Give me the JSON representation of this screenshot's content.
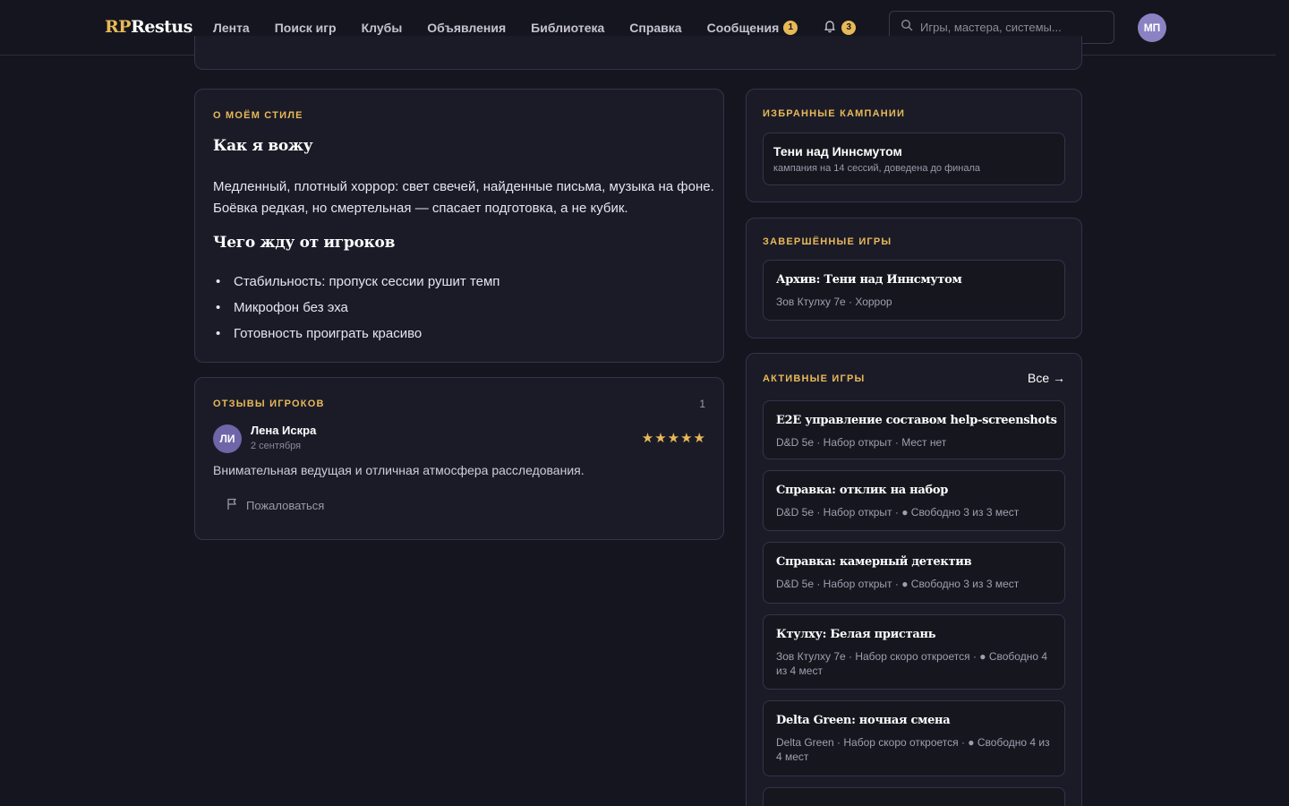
{
  "header": {
    "logo_rp": "RP",
    "logo_rest": "Restus",
    "nav": [
      {
        "label": "Лента"
      },
      {
        "label": "Поиск игр"
      },
      {
        "label": "Клубы"
      },
      {
        "label": "Объявления"
      },
      {
        "label": "Библиотека"
      },
      {
        "label": "Справка"
      },
      {
        "label": "Сообщения",
        "badge": "1"
      }
    ],
    "notifications_badge": "3",
    "search_placeholder": "Игры, мастера, системы...",
    "avatar_initials": "МП"
  },
  "style": {
    "section_title": "О моём стиле",
    "heading1": "Как я вожу",
    "paragraph": "Медленный, плотный хоррор: свет свечей, найденные письма, музыка на фоне. Боёвка редкая, но смертельная — спасает подготовка, а не кубик.",
    "heading2": "Чего жду от игроков",
    "bullets": [
      "Стабильность: пропуск сессии рушит темп",
      "Микрофон без эха",
      "Готовность проиграть красиво"
    ]
  },
  "reviews": {
    "section_title": "Отзывы игроков",
    "count": "1",
    "items": [
      {
        "initials": "ЛИ",
        "name": "Лена Искра",
        "date": "2 сентября",
        "rating": 5,
        "text": "Внимательная ведущая и отличная атмосфера расследования.",
        "report_label": "Пожаловаться"
      }
    ]
  },
  "favorites": {
    "section_title": "Избранные кампании",
    "items": [
      {
        "title": "Тени над Иннсмутом",
        "subtitle": "кампания на 14 сессий, доведена до финала"
      }
    ]
  },
  "completed": {
    "section_title": "Завершённые игры",
    "items": [
      {
        "title": "Архив: Тени над Иннсмутом",
        "subtitle": "Зов Ктулху 7е · Хоррор"
      }
    ]
  },
  "active": {
    "section_title": "Активные игры",
    "all_link": "Все →",
    "items": [
      {
        "title": "E2E управление составом help-screenshots",
        "subtitle": "D&D 5e · Набор открыт · Мест нет"
      },
      {
        "title": "Справка: отклик на набор",
        "subtitle": "D&D 5e · Набор открыт · ● Свободно 3 из 3 мест"
      },
      {
        "title": "Справка: камерный детектив",
        "subtitle": "D&D 5e · Набор открыт · ● Свободно 3 из 3 мест"
      },
      {
        "title": "Ктулху: Белая пристань",
        "subtitle": "Зов Ктулху 7е · Набор скоро откроется · ● Свободно 4 из 4 мест"
      },
      {
        "title": "Delta Green: ночная смена",
        "subtitle": "Delta Green · Набор скоро откроется · ● Свободно 4 из 4 мест"
      }
    ]
  },
  "colors": {
    "background": "#151520",
    "card": "#1b1b28",
    "accent": "#e8b957",
    "avatar": "#8b82c4"
  }
}
